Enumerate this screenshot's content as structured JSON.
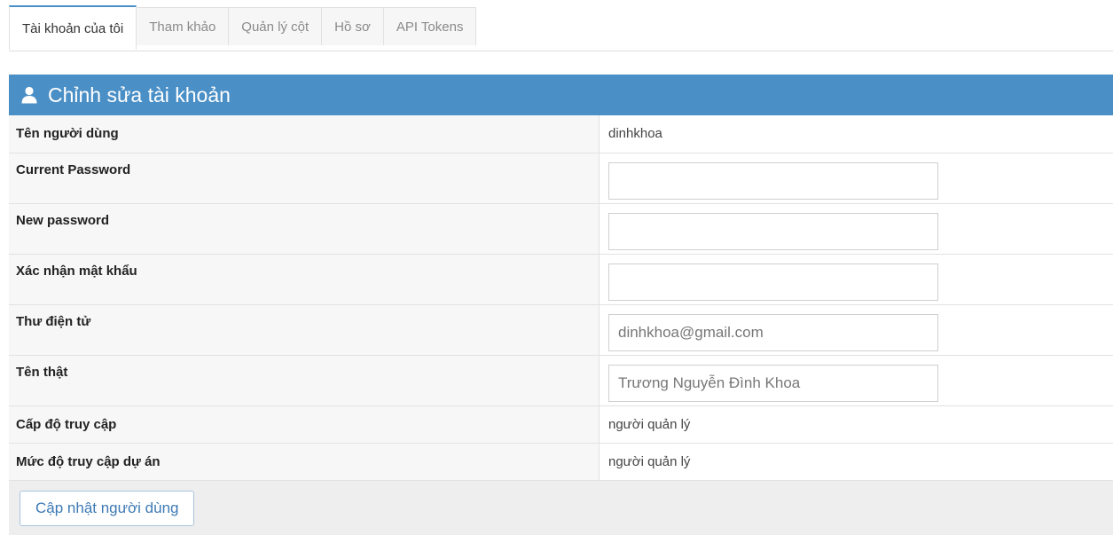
{
  "tabs": [
    {
      "label": "Tài khoản của tôi",
      "active": true
    },
    {
      "label": "Tham khảo",
      "active": false
    },
    {
      "label": "Quản lý cột",
      "active": false
    },
    {
      "label": "Hồ sơ",
      "active": false
    },
    {
      "label": "API Tokens",
      "active": false
    }
  ],
  "panel": {
    "title": "Chỉnh sửa tài khoản",
    "icon": "user-icon",
    "header_color": "#4a8fc6"
  },
  "form": {
    "username_label": "Tên người dùng",
    "username_value": "dinhkhoa",
    "current_password_label": "Current Password",
    "current_password_value": "",
    "new_password_label": "New password",
    "new_password_value": "",
    "confirm_password_label": "Xác nhận mật khẩu",
    "confirm_password_value": "",
    "email_label": "Thư điện tử",
    "email_value": "dinhkhoa@gmail.com",
    "realname_label": "Tên thật",
    "realname_value": "Trương Nguyễn Đình Khoa",
    "access_level_label": "Cấp độ truy cập",
    "access_level_value": "người quản lý",
    "project_access_label": "Mức độ truy cập dự án",
    "project_access_value": "người quản lý"
  },
  "actions": {
    "update_label": "Cập nhật người dùng"
  }
}
